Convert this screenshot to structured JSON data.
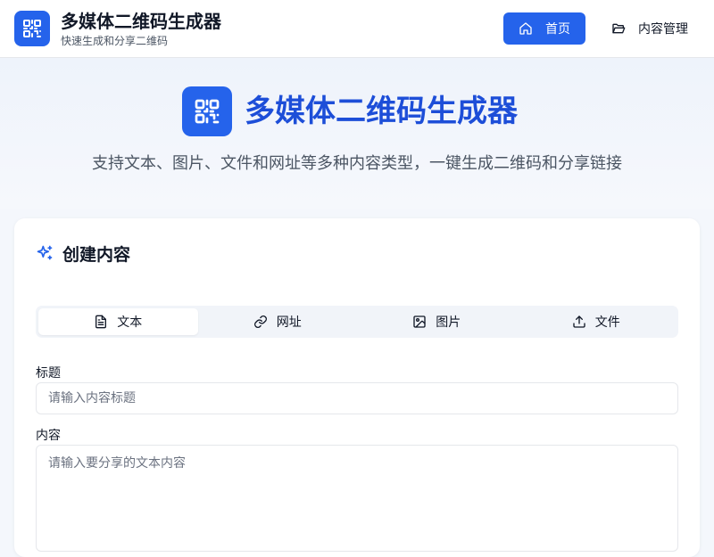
{
  "header": {
    "app_title": "多媒体二维码生成器",
    "app_subtitle": "快速生成和分享二维码",
    "nav": [
      {
        "label": "首页",
        "icon": "home-icon",
        "active": true
      },
      {
        "label": "内容管理",
        "icon": "folder-open-icon",
        "active": false
      }
    ]
  },
  "hero": {
    "title": "多媒体二维码生成器",
    "description": "支持文本、图片、文件和网址等多种内容类型，一键生成二维码和分享链接"
  },
  "create_card": {
    "title": "创建内容",
    "title_icon": "sparkles-icon",
    "tabs": [
      {
        "label": "文本",
        "icon": "file-text-icon",
        "active": true
      },
      {
        "label": "网址",
        "icon": "link-icon",
        "active": false
      },
      {
        "label": "图片",
        "icon": "image-icon",
        "active": false
      },
      {
        "label": "文件",
        "icon": "upload-icon",
        "active": false
      }
    ],
    "fields": {
      "title_label": "标题",
      "title_placeholder": "请输入内容标题",
      "title_value": "",
      "content_label": "内容",
      "content_placeholder": "请输入要分享的文本内容",
      "content_value": ""
    }
  },
  "colors": {
    "primary": "#2563eb",
    "hero_title": "#1d4ed8",
    "page_background": "#f4f7fc"
  }
}
